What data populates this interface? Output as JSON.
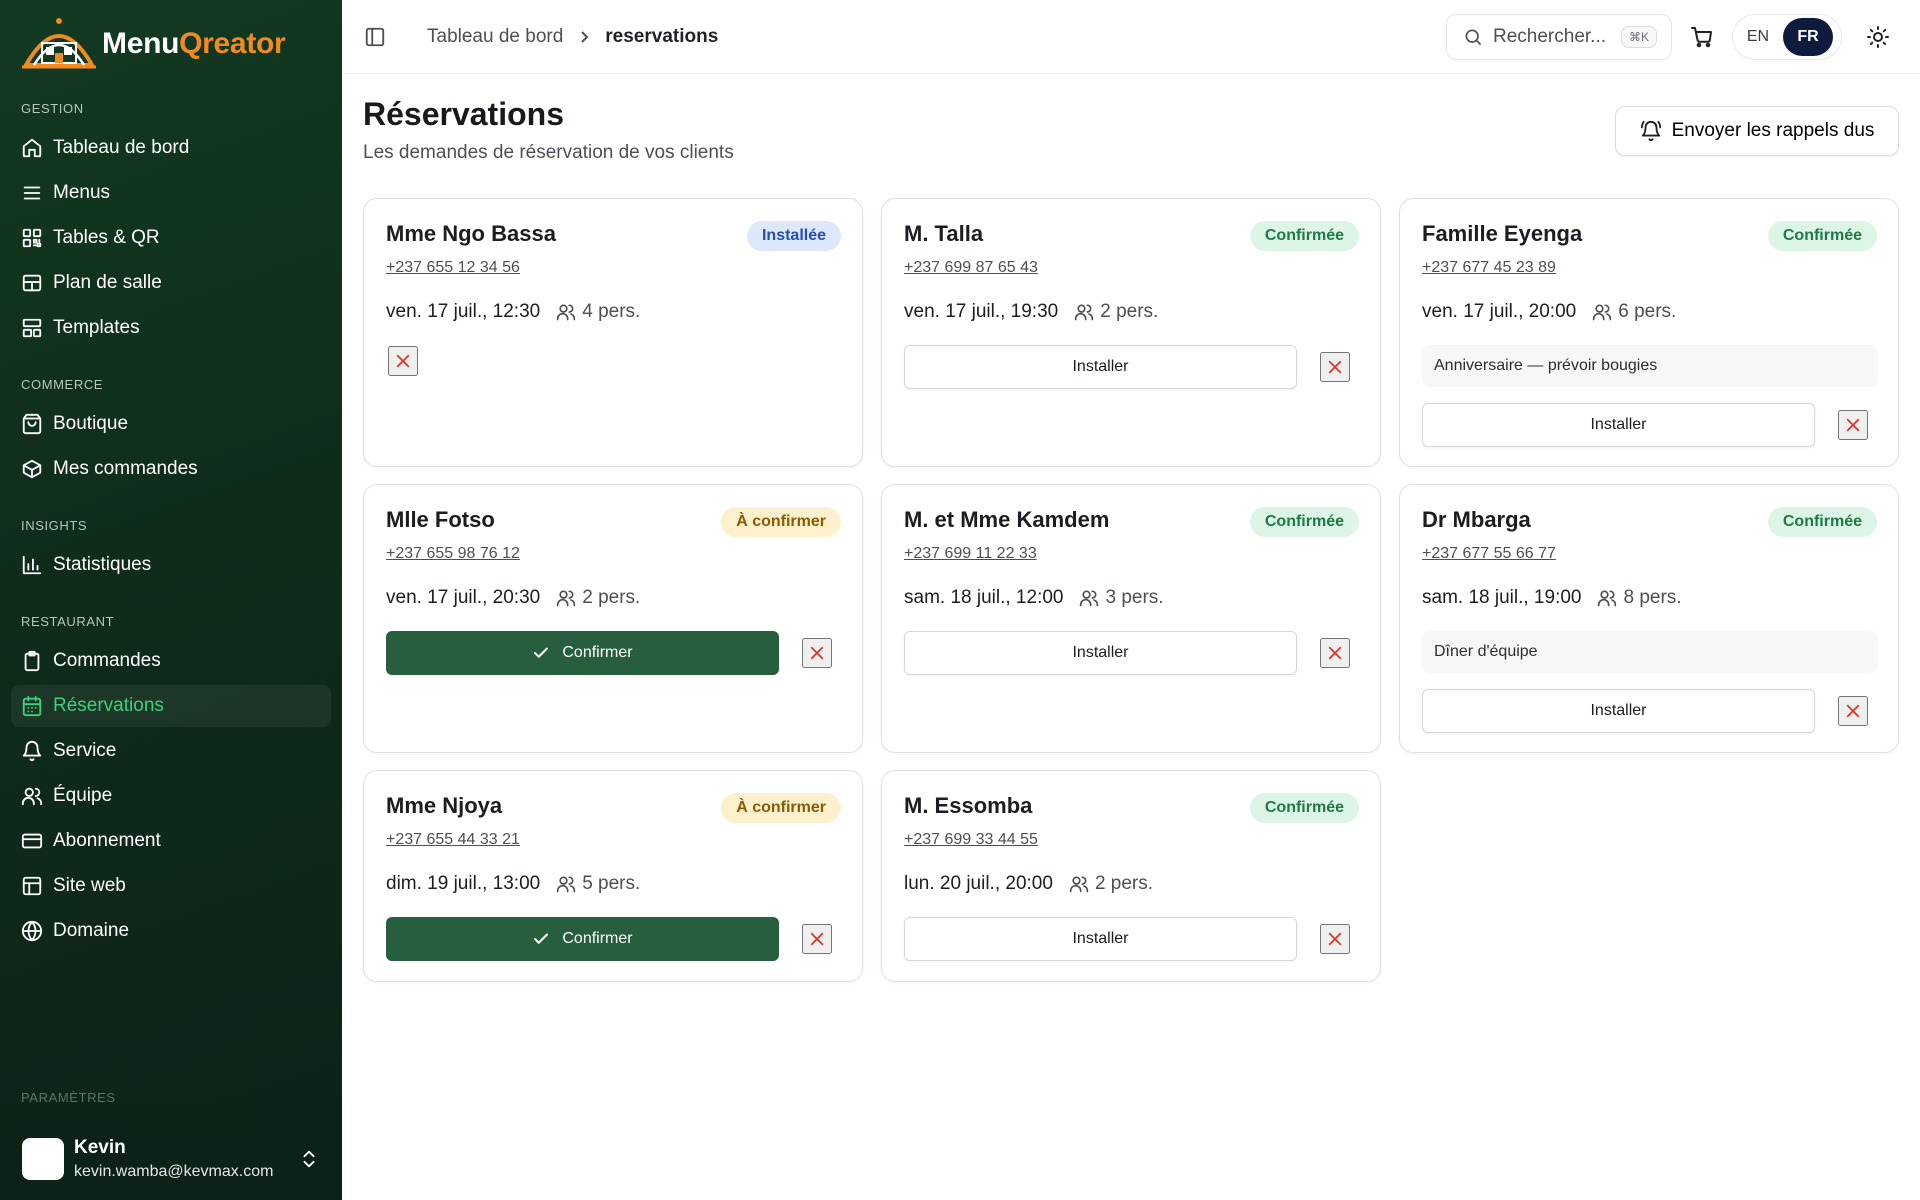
{
  "brand": {
    "word1": "Menu",
    "word2": "Qreator"
  },
  "sidebar": {
    "sections": [
      {
        "label": "GESTION",
        "items": [
          {
            "label": "Tableau de bord",
            "icon": "home-icon"
          },
          {
            "label": "Menus",
            "icon": "menu-lines-icon"
          },
          {
            "label": "Tables & QR",
            "icon": "qr-icon"
          },
          {
            "label": "Plan de salle",
            "icon": "floor-plan-icon"
          },
          {
            "label": "Templates",
            "icon": "template-icon"
          }
        ]
      },
      {
        "label": "COMMERCE",
        "items": [
          {
            "label": "Boutique",
            "icon": "shopping-bag-icon"
          },
          {
            "label": "Mes commandes",
            "icon": "package-icon"
          }
        ]
      },
      {
        "label": "INSIGHTS",
        "items": [
          {
            "label": "Statistiques",
            "icon": "bar-chart-icon"
          }
        ]
      },
      {
        "label": "RESTAURANT",
        "items": [
          {
            "label": "Commandes",
            "icon": "clipboard-icon"
          },
          {
            "label": "Réservations",
            "icon": "calendar-icon",
            "active": true
          },
          {
            "label": "Service",
            "icon": "bell-icon"
          },
          {
            "label": "Équipe",
            "icon": "users-icon"
          },
          {
            "label": "Abonnement",
            "icon": "credit-card-icon"
          },
          {
            "label": "Site web",
            "icon": "layout-icon"
          },
          {
            "label": "Domaine",
            "icon": "globe-icon"
          }
        ]
      }
    ],
    "next_section_label": "PARAMÈTRES",
    "user": {
      "name": "Kevin",
      "email": "kevin.wamba@kevmax.com"
    }
  },
  "topbar": {
    "breadcrumb": [
      "Tableau de bord",
      "reservations"
    ],
    "search_placeholder": "Rechercher...",
    "search_shortcut": "⌘K",
    "languages": [
      "EN",
      "FR"
    ],
    "active_language": "FR"
  },
  "page": {
    "title": "Réservations",
    "subtitle": "Les demandes de réservation de vos clients",
    "reminder_button": "Envoyer les rappels dus"
  },
  "labels": {
    "install": "Installer",
    "confirm": "Confirmer"
  },
  "colors": {
    "sidebar_bg": "#0f2c1b",
    "brand_orange": "#f28a1e",
    "active_green": "#3fd07a",
    "confirm_green": "#275e3d",
    "cancel_red": "#d9362b"
  },
  "reservations": [
    {
      "name": "Mme Ngo Bassa",
      "status": "Installée",
      "status_kind": "installee",
      "phone": "+237 655 12 34 56",
      "date": "ven. 17 juil., 12:30",
      "guests": "4 pers.",
      "note": "",
      "action": "none"
    },
    {
      "name": "M. Talla",
      "status": "Confirmée",
      "status_kind": "confirmee",
      "phone": "+237 699 87 65 43",
      "date": "ven. 17 juil., 19:30",
      "guests": "2 pers.",
      "note": "",
      "action": "install"
    },
    {
      "name": "Famille Eyenga",
      "status": "Confirmée",
      "status_kind": "confirmee",
      "phone": "+237 677 45 23 89",
      "date": "ven. 17 juil., 20:00",
      "guests": "6 pers.",
      "note": "Anniversaire — prévoir bougies",
      "action": "install"
    },
    {
      "name": "Mlle Fotso",
      "status": "À confirmer",
      "status_kind": "aconfirmer",
      "phone": "+237 655 98 76 12",
      "date": "ven. 17 juil., 20:30",
      "guests": "2 pers.",
      "note": "",
      "action": "confirm"
    },
    {
      "name": "M. et Mme Kamdem",
      "status": "Confirmée",
      "status_kind": "confirmee",
      "phone": "+237 699 11 22 33",
      "date": "sam. 18 juil., 12:00",
      "guests": "3 pers.",
      "note": "",
      "action": "install"
    },
    {
      "name": "Dr Mbarga",
      "status": "Confirmée",
      "status_kind": "confirmee",
      "phone": "+237 677 55 66 77",
      "date": "sam. 18 juil., 19:00",
      "guests": "8 pers.",
      "note": "Dîner d'équipe",
      "action": "install"
    },
    {
      "name": "Mme Njoya",
      "status": "À confirmer",
      "status_kind": "aconfirmer",
      "phone": "+237 655 44 33 21",
      "date": "dim. 19 juil., 13:00",
      "guests": "5 pers.",
      "note": "",
      "action": "confirm"
    },
    {
      "name": "M. Essomba",
      "status": "Confirmée",
      "status_kind": "confirmee",
      "phone": "+237 699 33 44 55",
      "date": "lun. 20 juil., 20:00",
      "guests": "2 pers.",
      "note": "",
      "action": "install"
    }
  ]
}
